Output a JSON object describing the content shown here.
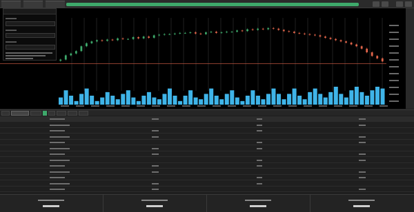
{
  "colors": {
    "accent": "#3ea96b",
    "bull": "#3ea96b",
    "bear": "#e0644a",
    "volume": "#3fb4e8",
    "level_line": "#e0644a"
  },
  "icons": [
    "close-icon",
    "settings-icon"
  ],
  "chart_data": {
    "type": "candlestick",
    "title": "",
    "xlabel": "",
    "ylabel": "",
    "grid": false,
    "legend": "none",
    "y_range": [
      0,
      100
    ],
    "level": 31,
    "close": [
      38,
      45,
      48,
      52,
      60,
      65,
      68,
      70,
      69,
      71,
      70,
      73,
      72,
      72,
      75,
      73,
      76,
      74,
      78,
      79,
      80,
      80,
      81,
      82,
      82,
      83,
      81,
      80,
      83,
      84,
      82,
      83,
      84,
      84,
      86,
      85,
      88,
      87,
      89,
      88,
      90,
      89,
      87,
      85,
      84,
      82,
      81,
      80,
      79,
      78,
      76,
      74,
      72,
      70,
      68,
      66,
      63,
      60,
      56,
      50,
      44,
      40,
      35
    ],
    "volume": [
      0.4,
      0.8,
      0.5,
      0.2,
      0.6,
      0.9,
      0.5,
      0.2,
      0.4,
      0.7,
      0.5,
      0.3,
      0.6,
      0.8,
      0.4,
      0.2,
      0.5,
      0.7,
      0.4,
      0.3,
      0.6,
      0.9,
      0.5,
      0.2,
      0.5,
      0.8,
      0.4,
      0.3,
      0.6,
      0.9,
      0.5,
      0.3,
      0.6,
      0.8,
      0.4,
      0.2,
      0.5,
      0.8,
      0.5,
      0.3,
      0.6,
      0.9,
      0.6,
      0.3,
      0.6,
      0.9,
      0.5,
      0.3,
      0.7,
      0.9,
      0.6,
      0.4,
      0.7,
      1.0,
      0.6,
      0.4,
      0.8,
      1.0,
      0.7,
      0.5,
      0.8,
      1.0,
      0.9
    ]
  },
  "table": {
    "rows": 13
  }
}
